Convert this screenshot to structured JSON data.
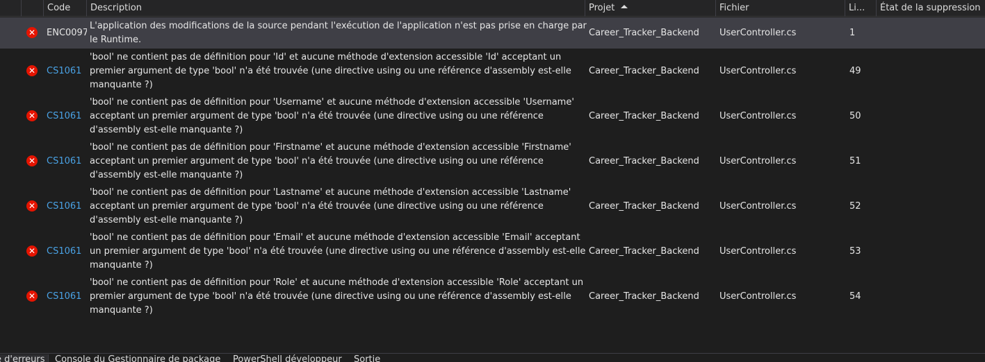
{
  "columns": {
    "code": "Code",
    "description": "Description",
    "project": "Projet",
    "file": "Fichier",
    "line": "Li...",
    "suppression": "État de la suppression"
  },
  "rows": [
    {
      "code": "ENC0097",
      "code_is_link": false,
      "description": "L'application des modifications de la source pendant l'exécution de l'application n'est pas prise en charge par le Runtime.",
      "project": "Career_Tracker_Backend",
      "file": "UserController.cs",
      "line": "1",
      "selected": true
    },
    {
      "code": "CS1061",
      "code_is_link": true,
      "description": "'bool' ne contient pas de définition pour 'Id' et aucune méthode d'extension accessible 'Id' acceptant un premier argument de type 'bool' n'a été trouvée (une directive using ou une référence d'assembly est-elle manquante ?)",
      "project": "Career_Tracker_Backend",
      "file": "UserController.cs",
      "line": "49",
      "selected": false
    },
    {
      "code": "CS1061",
      "code_is_link": true,
      "description": "'bool' ne contient pas de définition pour 'Username' et aucune méthode d'extension accessible 'Username' acceptant un premier argument de type 'bool' n'a été trouvée (une directive using ou une référence d'assembly est-elle manquante ?)",
      "project": "Career_Tracker_Backend",
      "file": "UserController.cs",
      "line": "50",
      "selected": false
    },
    {
      "code": "CS1061",
      "code_is_link": true,
      "description": "'bool' ne contient pas de définition pour 'Firstname' et aucune méthode d'extension accessible 'Firstname' acceptant un premier argument de type 'bool' n'a été trouvée (une directive using ou une référence d'assembly est-elle manquante ?)",
      "project": "Career_Tracker_Backend",
      "file": "UserController.cs",
      "line": "51",
      "selected": false
    },
    {
      "code": "CS1061",
      "code_is_link": true,
      "description": "'bool' ne contient pas de définition pour 'Lastname' et aucune méthode d'extension accessible 'Lastname' acceptant un premier argument de type 'bool' n'a été trouvée (une directive using ou une référence d'assembly est-elle manquante ?)",
      "project": "Career_Tracker_Backend",
      "file": "UserController.cs",
      "line": "52",
      "selected": false
    },
    {
      "code": "CS1061",
      "code_is_link": true,
      "description": "'bool' ne contient pas de définition pour 'Email' et aucune méthode d'extension accessible 'Email' acceptant un premier argument de type 'bool' n'a été trouvée (une directive using ou une référence d'assembly est-elle manquante ?)",
      "project": "Career_Tracker_Backend",
      "file": "UserController.cs",
      "line": "53",
      "selected": false
    },
    {
      "code": "CS1061",
      "code_is_link": true,
      "description": "'bool' ne contient pas de définition pour 'Role' et aucune méthode d'extension accessible 'Role' acceptant un premier argument de type 'bool' n'a été trouvée (une directive using ou une référence d'assembly est-elle manquante ?)",
      "project": "Career_Tracker_Backend",
      "file": "UserController.cs",
      "line": "54",
      "selected": false
    }
  ],
  "bottom_tabs": [
    {
      "label": "e d'erreurs",
      "active": true
    },
    {
      "label": "Console du Gestionnaire de package",
      "active": false
    },
    {
      "label": "PowerShell développeur",
      "active": false
    },
    {
      "label": "Sortie",
      "active": false
    }
  ],
  "colors": {
    "error": "#e51400",
    "link": "#4aa3e6",
    "selected_row": "#3f3f46"
  },
  "icons": {
    "error": "error-icon",
    "sort": "sort-ascending-icon"
  }
}
